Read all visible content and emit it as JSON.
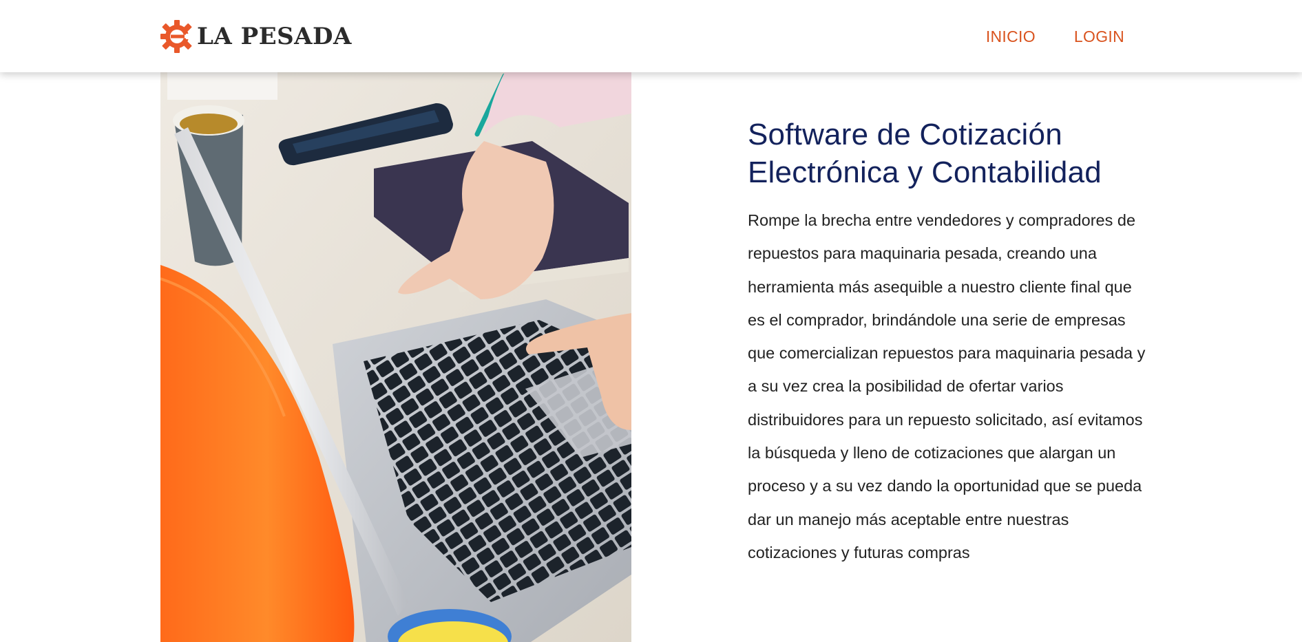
{
  "brand": {
    "name": "LA PESADA",
    "logo_icon": "gear-e-icon",
    "accent_color": "#e9582a"
  },
  "nav": {
    "items": [
      {
        "label": "INICIO"
      },
      {
        "label": "LOGIN"
      }
    ],
    "link_color": "#d9531e"
  },
  "hero": {
    "image_icon": "laptop-workspace-photo",
    "title": "Software de Cotización Electrónica y Contabilidad",
    "title_color": "#13225c",
    "description": "Rompe la brecha entre vendedores y compradores de repuestos para maquinaria pesada, creando una herramienta más asequible a nuestro cliente final que es el comprador, brindándole una serie de empresas que comercializan repuestos para maquinaria pesada y a su vez crea la posibilidad de ofertar varios distribuidores para un repuesto solicitado, así evitamos la búsqueda y lleno de cotizaciones que alargan un proceso y a su vez dando la oportunidad que se pueda dar un manejo más aceptable entre nuestras cotizaciones y futuras compras"
  }
}
